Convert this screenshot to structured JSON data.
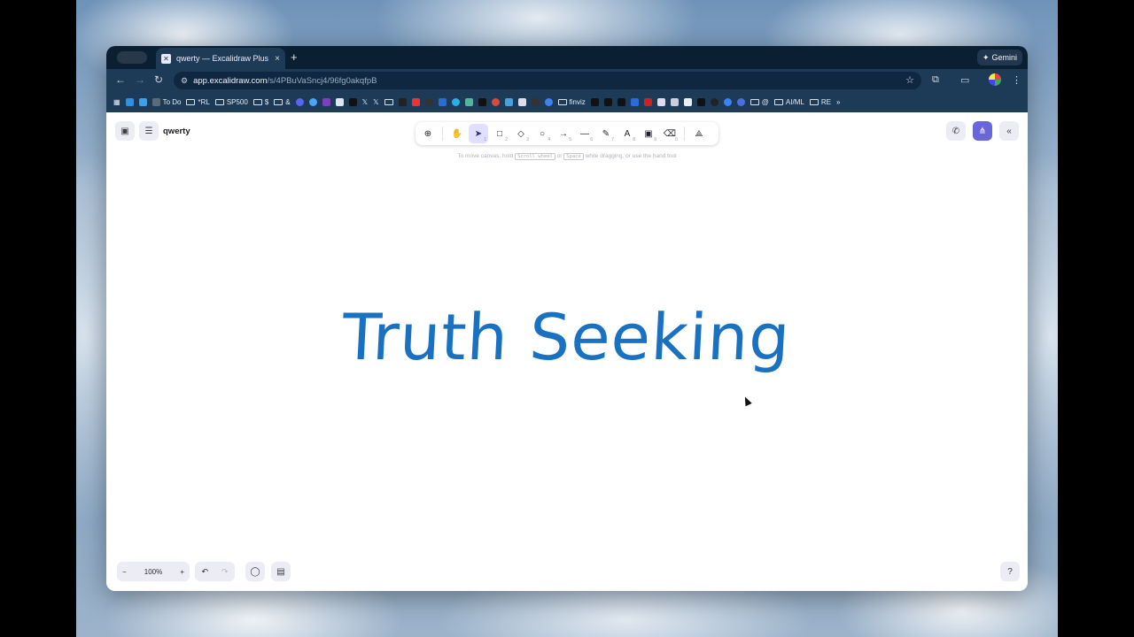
{
  "browser": {
    "tab_title": "qwerty — Excalidraw Plus",
    "tab_close": "×",
    "new_tab": "+",
    "gemini_label": "Gemini",
    "url_host": "app.excalidraw.com",
    "url_path": "/s/4PBuVaSncj4/96fg0akqfpB",
    "bookmarks": [
      {
        "label": "To Do"
      },
      {
        "label": "*RL"
      },
      {
        "label": "SP500"
      },
      {
        "label": "$"
      },
      {
        "label": "&"
      },
      {
        "label": "finviz"
      },
      {
        "label": "@"
      },
      {
        "label": "AI/ML"
      },
      {
        "label": "RE"
      }
    ],
    "icons": [
      "back-icon",
      "forward-icon",
      "reload-icon",
      "site-settings-icon",
      "star-icon",
      "extensions-icon",
      "cast-icon",
      "menu-icon"
    ]
  },
  "app": {
    "doc_name": "qwerty",
    "hint": {
      "prefix": "To move canvas, hold",
      "key1": "Scroll wheel",
      "mid": "or",
      "key2": "Space",
      "suffix": "while dragging, or use the hand tool"
    },
    "tools": [
      {
        "name": "lock",
        "glyph": "⊕",
        "key": ""
      },
      {
        "name": "hand",
        "glyph": "✋",
        "key": ""
      },
      {
        "name": "selection",
        "glyph": "➤",
        "key": "1",
        "active": true
      },
      {
        "name": "rectangle",
        "glyph": "□",
        "key": "2"
      },
      {
        "name": "diamond",
        "glyph": "◇",
        "key": "3"
      },
      {
        "name": "ellipse",
        "glyph": "○",
        "key": "4"
      },
      {
        "name": "arrow",
        "glyph": "→",
        "key": "5"
      },
      {
        "name": "line",
        "glyph": "—",
        "key": "6"
      },
      {
        "name": "draw",
        "glyph": "✎",
        "key": "7"
      },
      {
        "name": "text",
        "glyph": "A",
        "key": "8"
      },
      {
        "name": "image",
        "glyph": "▣",
        "key": "9"
      },
      {
        "name": "eraser",
        "glyph": "⌫",
        "key": "0"
      },
      {
        "name": "more-tools",
        "glyph": "⟁",
        "key": ""
      }
    ],
    "canvas_text": "Truth Seeking",
    "text_color": "#1971c2",
    "zoom": "100%",
    "zoom_out": "−",
    "zoom_in": "+",
    "accent": "#6965db"
  }
}
